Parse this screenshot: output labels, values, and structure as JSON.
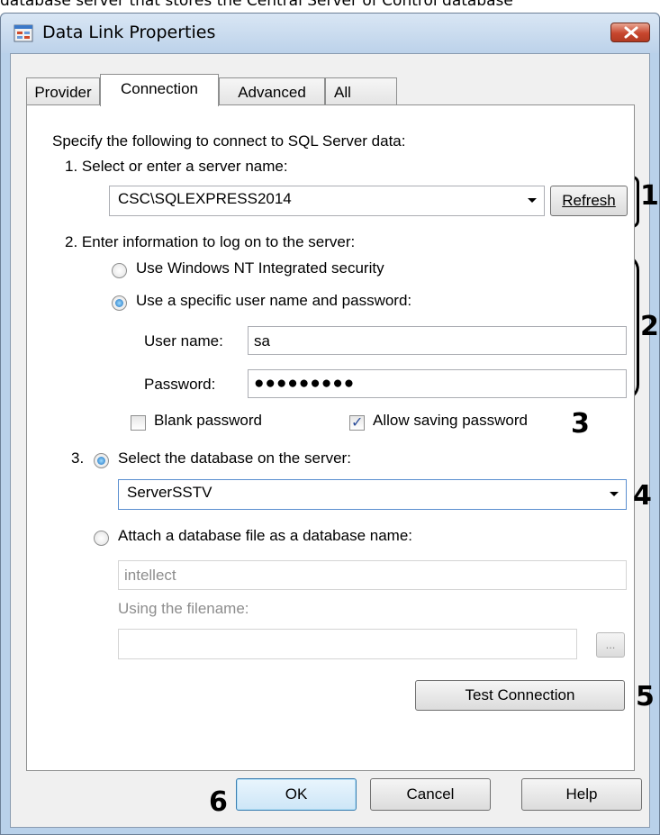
{
  "caption": "database server that stores the Central Server of Control database",
  "window": {
    "title": "Data Link Properties",
    "icon": "data-link-icon",
    "close_icon": "close-icon"
  },
  "tabs": [
    {
      "label": "Provider",
      "active": false
    },
    {
      "label": "Connection",
      "active": true
    },
    {
      "label": "Advanced",
      "active": false
    },
    {
      "label": "All",
      "active": false
    }
  ],
  "connection": {
    "intro": "Specify the following to connect to SQL Server data:",
    "step1_label": "1. Select or enter a server name:",
    "server_name": "CSC\\SQLEXPRESS2014",
    "refresh_label": "Refresh",
    "step2_label": "2. Enter information to log on to the server:",
    "windows_security_label": "Use Windows NT Integrated security",
    "specific_user_label": "Use a specific user name and password:",
    "username_label": "User name:",
    "username_value": "sa",
    "password_label": "Password:",
    "password_value": "●●●●●●●●●",
    "blank_password_label": "Blank password",
    "blank_password_checked": false,
    "allow_saving_label": "Allow saving password",
    "allow_saving_checked": true,
    "step3_prefix": "3.",
    "select_db_label": "Select the database on the server:",
    "database_value": "ServerSSTV",
    "attach_label": "Attach a database file as a database name:",
    "attach_value": "intellect",
    "filename_label": "Using the filename:",
    "filename_value": "",
    "browse_label": "...",
    "test_connection_label": "Test Connection"
  },
  "footer": {
    "ok_label": "OK",
    "cancel_label": "Cancel",
    "help_label": "Help"
  },
  "callouts": [
    "1",
    "2",
    "3",
    "4",
    "5",
    "6"
  ]
}
